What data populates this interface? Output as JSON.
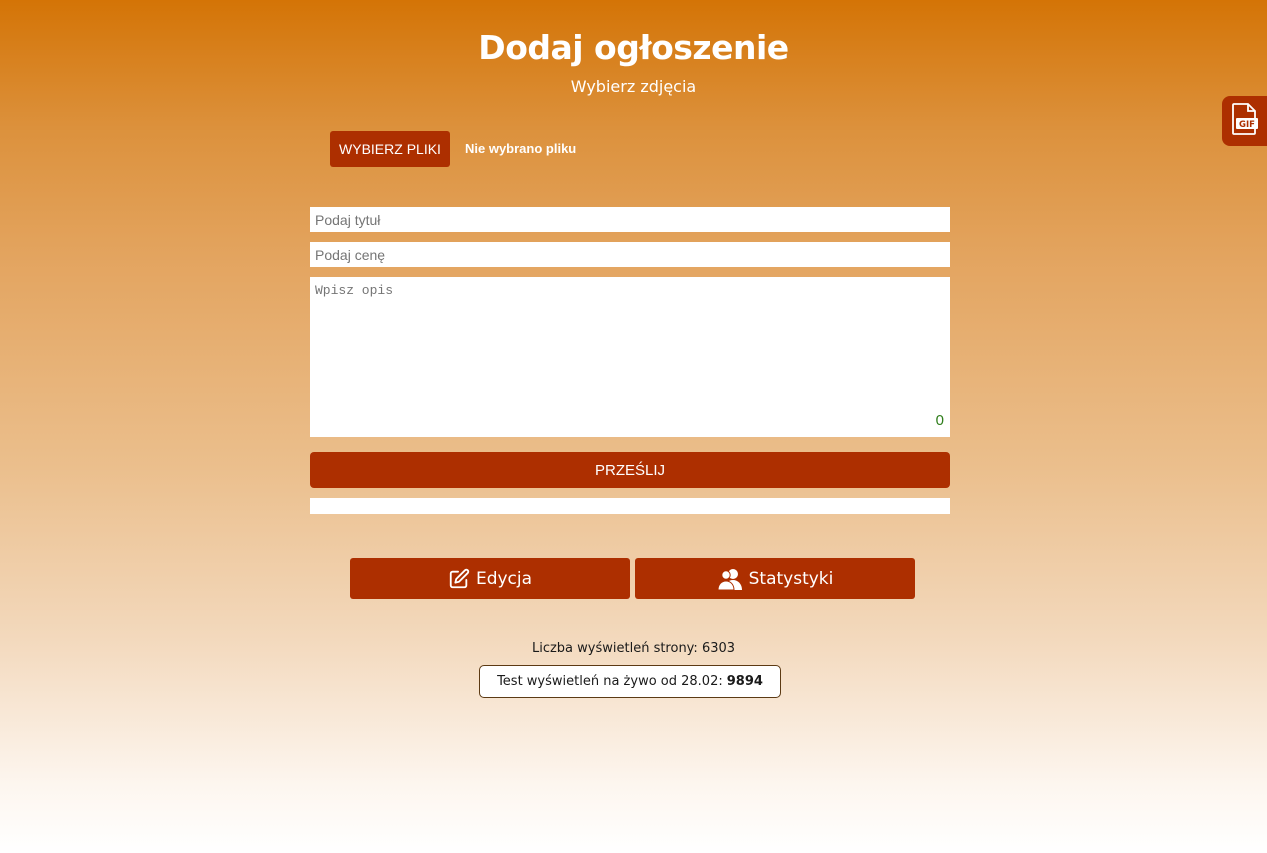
{
  "header": {
    "title": "Dodaj ogłoszenie",
    "subtitle": "Wybierz zdjęcia"
  },
  "upload": {
    "button_label": "WYBIERZ PLIKI",
    "status": "Nie wybrano pliku"
  },
  "form": {
    "title_placeholder": "Podaj tytuł",
    "title_value": "",
    "price_placeholder": "Podaj cenę",
    "price_value": "",
    "description_placeholder": "Wpisz opis",
    "description_value": "",
    "char_count": "0",
    "submit_label": "PRZEŚLIJ",
    "progress": 0
  },
  "nav": {
    "edit_label": "Edycja",
    "edit_icon": "edit-icon",
    "stats_label": "Statystyki",
    "stats_icon": "users-icon"
  },
  "stats": {
    "views_text": "Liczba wyświetleń strony: 6303",
    "live_label": "Test wyświetleń na żywo od 28.02:",
    "live_count": "9894"
  },
  "side_tab": {
    "icon": "gif-file-icon"
  },
  "colors": {
    "accent": "#ad2f00",
    "gradient_top": "#d47406",
    "gradient_bottom": "#ffffff",
    "counter": "#2e7d1a"
  }
}
